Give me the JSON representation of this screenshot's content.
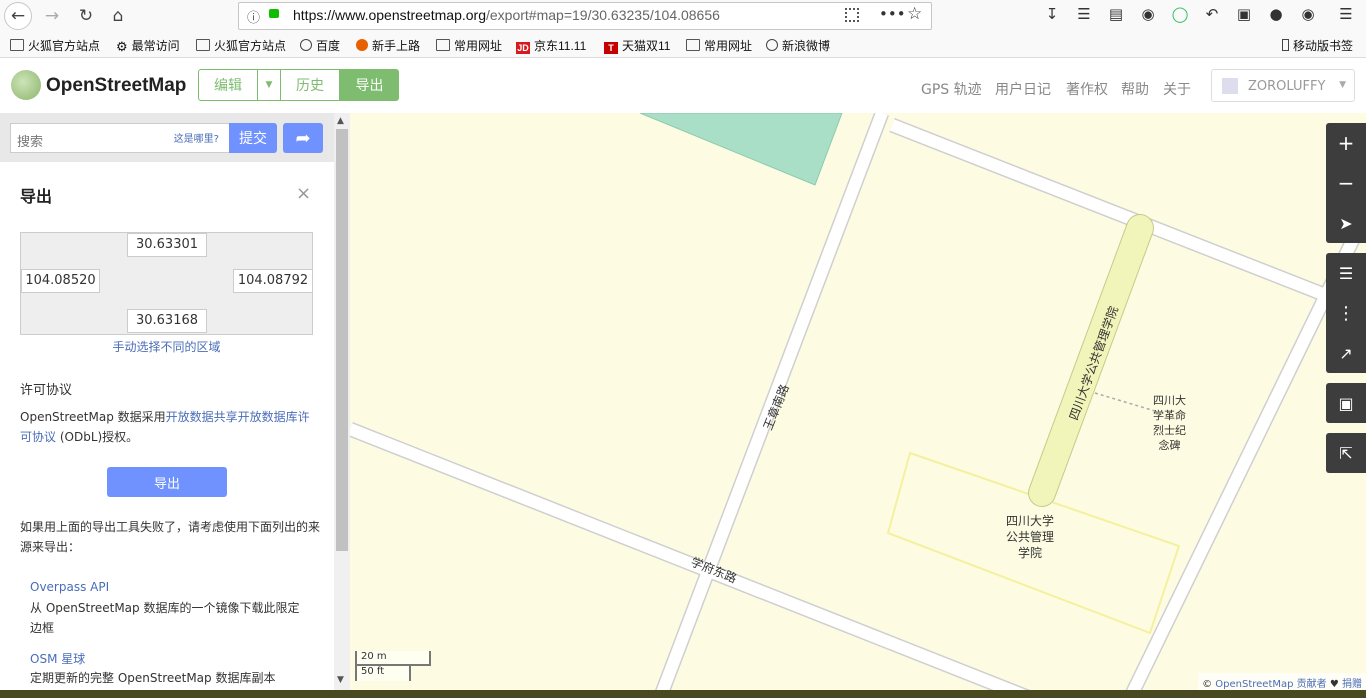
{
  "browser": {
    "url_host": "https://www.openstreetmap.org",
    "url_path": "/export#map=19/30.63235/104.08656",
    "bookmarks": [
      "火狐官方站点",
      "最常访问",
      "火狐官方站点",
      "百度",
      "新手上路",
      "常用网址",
      "京东11.11",
      "天猫双11",
      "常用网址",
      "新浪微博"
    ],
    "mobile_bookmarks": "移动版书签"
  },
  "header": {
    "site_name": "OpenStreetMap",
    "edit_label": "编辑",
    "history_label": "历史",
    "export_label": "导出",
    "nav": [
      "GPS 轨迹",
      "用户日记",
      "著作权",
      "帮助",
      "关于"
    ],
    "user": "ZOROLUFFY"
  },
  "sidebar": {
    "search_placeholder": "搜索",
    "where_is_this": "这是哪里?",
    "submit_label": "提交",
    "export_title": "导出",
    "close": "×",
    "bbox": {
      "top": "30.63301",
      "left": "104.08520",
      "right": "104.08792",
      "bottom": "30.63168"
    },
    "manual_select": "手动选择不同的区域",
    "license_heading": "许可协议",
    "license_prefix": "OpenStreetMap 数据采用",
    "license_link": "开放数据共享开放数据库许可协议",
    "license_suffix": " (ODbL)授权。",
    "export_button": "导出",
    "fallback_text": "如果用上面的导出工具失败了，请考虑使用下面列出的来源来导出：",
    "sources": [
      {
        "name": "Overpass API",
        "desc": "从 OpenStreetMap 数据库的一个镜像下载此限定边框"
      },
      {
        "name": "OSM 星球",
        "desc": "定期更新的完整 OpenStreetMap 数据库副本"
      }
    ]
  },
  "map": {
    "labels": {
      "road_wangzhang": "王章南路",
      "road_xuefu": "学府东路",
      "building_path": "四川大学公共管理学院",
      "monument": [
        "四川大",
        "学革命",
        "烈士纪",
        "念碑"
      ],
      "building": [
        "四川大学",
        "公共管理",
        "学院"
      ]
    },
    "scale_m": "20 m",
    "scale_ft": "50 ft",
    "attribution_prefix": "© ",
    "attribution_link": "OpenStreetMap 贡献者",
    "attribution_heart": " ♥ ",
    "attribution_donate": "捐赠"
  },
  "colors": {
    "osm_green": "#7ebc6f",
    "button_blue": "#7092ff",
    "map_bg": "#fdfce2",
    "park": "#a8dfc6"
  }
}
